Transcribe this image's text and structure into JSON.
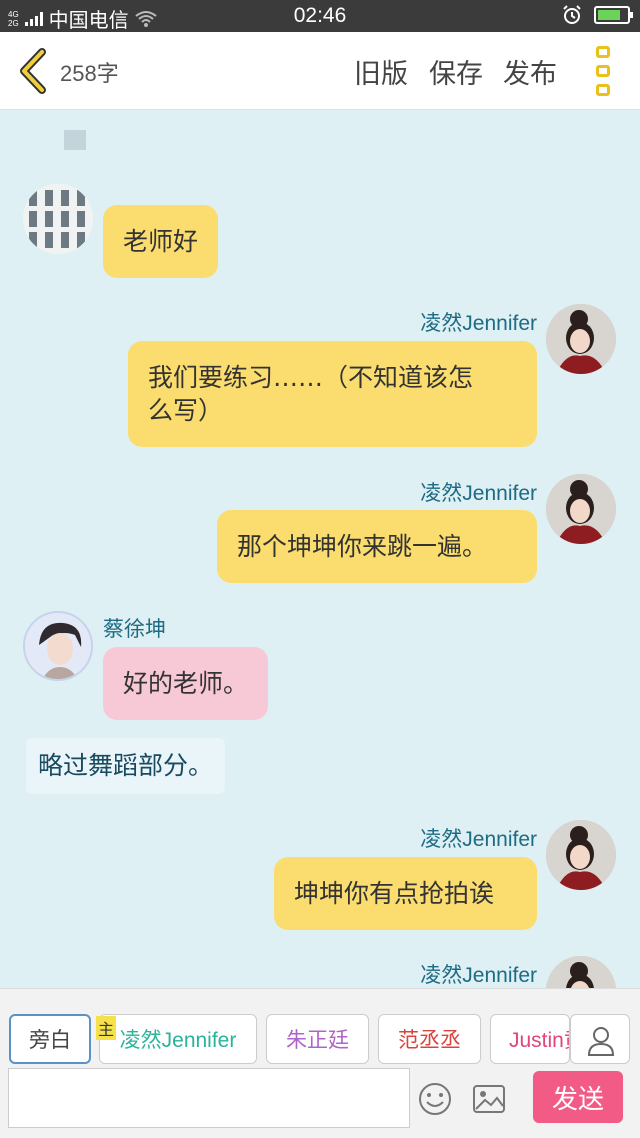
{
  "status_bar": {
    "network_top": "4G",
    "network_bottom": "2G",
    "carrier": "中国电信",
    "time": "02:46"
  },
  "header": {
    "word_count": "258字",
    "old_version": "旧版",
    "save": "保存",
    "publish": "发布"
  },
  "messages": [
    {
      "speaker": "",
      "text": "老师好",
      "side": "left",
      "color": "yellow"
    },
    {
      "speaker": "凌然Jennifer",
      "text": "我们要练习……（不知道该怎么写）",
      "line1": "我们要练习……（不知道该怎",
      "line2": "么写）",
      "side": "right",
      "color": "yellow"
    },
    {
      "speaker": "凌然Jennifer",
      "text": "那个坤坤你来跳一遍。",
      "side": "right",
      "color": "yellow"
    },
    {
      "speaker": "蔡徐坤",
      "text": "好的老师。",
      "side": "left",
      "color": "pink"
    },
    {
      "speaker": "",
      "text": "略过舞蹈部分。",
      "side": "narration",
      "color": "plain"
    },
    {
      "speaker": "凌然Jennifer",
      "text": "坤坤你有点抢拍诶",
      "side": "right",
      "color": "yellow"
    },
    {
      "speaker": "凌然Jennifer",
      "text": "",
      "side": "right",
      "color": "yellow"
    }
  ],
  "roles": [
    {
      "label": "旁白",
      "selected": true,
      "color": "#333333"
    },
    {
      "label": "凌然Jennifer",
      "selected": false,
      "color": "#2bb39a",
      "tag": "主"
    },
    {
      "label": "朱正廷",
      "selected": false,
      "color": "#b064c8"
    },
    {
      "label": "范丞丞",
      "selected": false,
      "color": "#d8433c"
    },
    {
      "label": "Justin黄",
      "selected": false,
      "color": "#e0457b"
    }
  ],
  "composer": {
    "placeholder": "",
    "send_label": "发送"
  },
  "colors": {
    "accent_yellow": "#fadd6e",
    "pink_bubble": "#f7c8d6",
    "send_button": "#f25b86",
    "chat_background": "#def0f3"
  },
  "icons": [
    "back-chevron-icon",
    "more-menu-icon",
    "user-icon",
    "emoji-icon",
    "image-icon",
    "wifi-icon",
    "alarm-icon",
    "battery-icon"
  ]
}
